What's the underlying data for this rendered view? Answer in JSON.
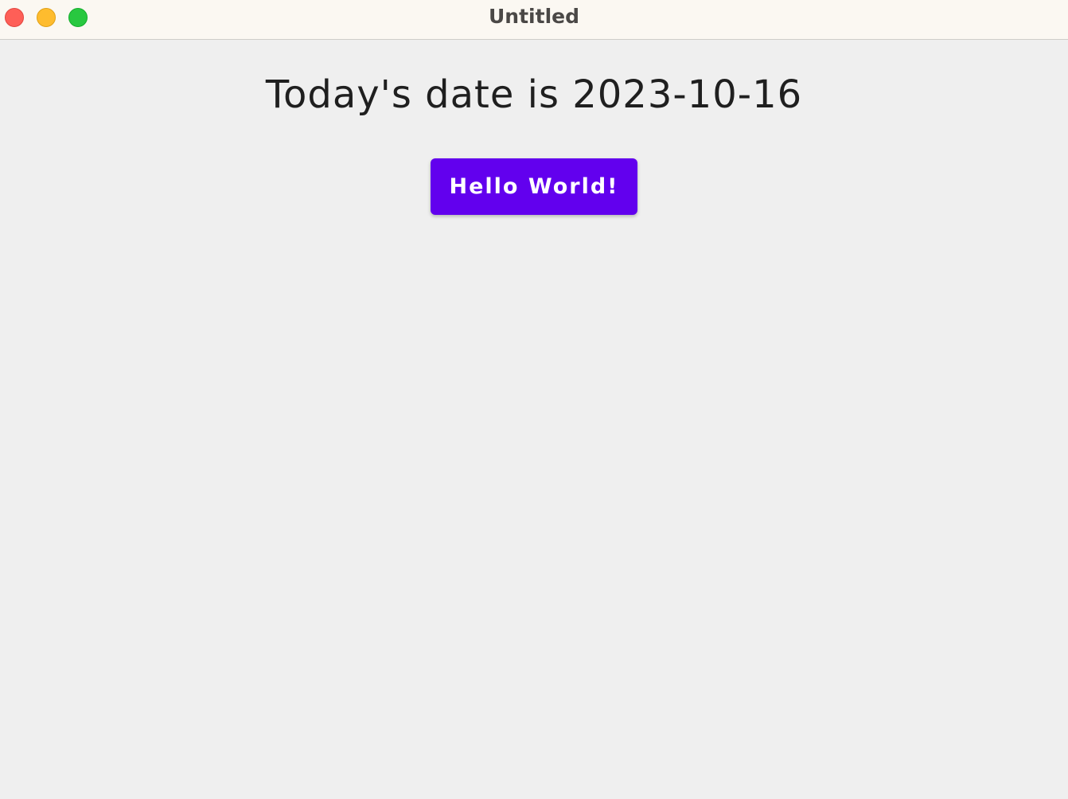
{
  "window": {
    "title": "Untitled",
    "controls": {
      "close": "close-window",
      "minimize": "minimize-window",
      "zoom": "zoom-window"
    }
  },
  "main": {
    "heading": "Today's date is 2023-10-16",
    "button_label": "Hello World!"
  },
  "colors": {
    "accent": "#6200ee",
    "background": "#efefef",
    "titlebar": "#fbf8f2",
    "close": "#fe5f57",
    "minimize": "#febc2e",
    "zoom": "#28c840"
  }
}
